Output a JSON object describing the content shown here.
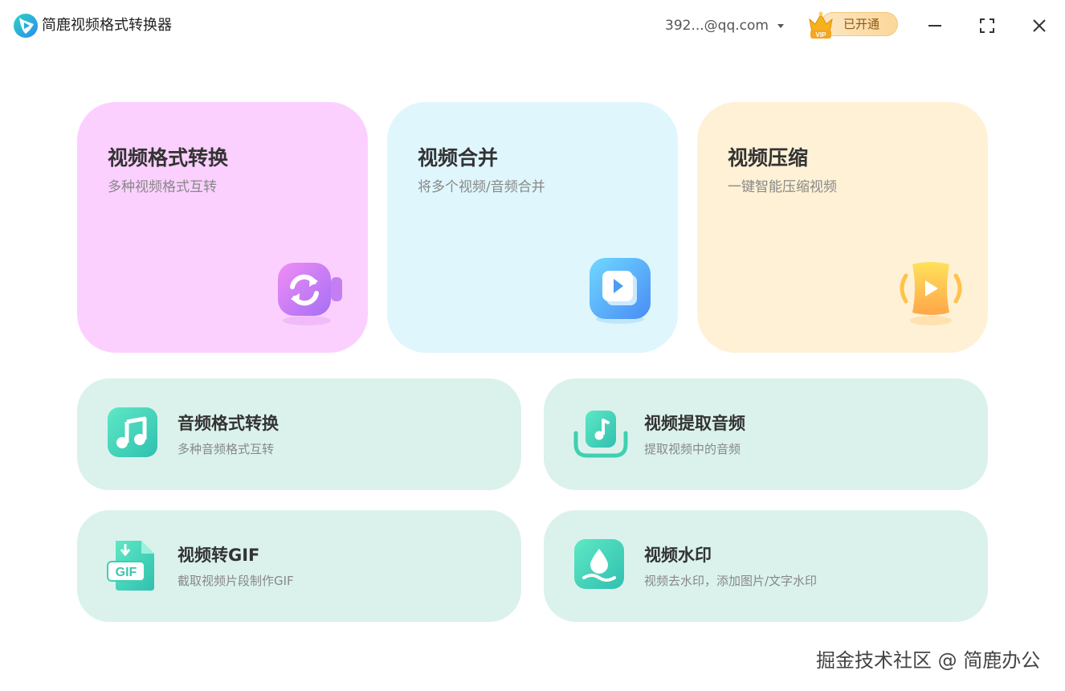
{
  "app": {
    "title": "简鹿视频格式转换器",
    "account": "392...@qq.com",
    "vip_badge": "VIP",
    "vip_status": "已开通"
  },
  "tools_main": [
    {
      "title": "视频格式转换",
      "subtitle": "多种视频格式互转"
    },
    {
      "title": "视频合并",
      "subtitle": "将多个视频/音频合并"
    },
    {
      "title": "视频压缩",
      "subtitle": "一键智能压缩视频"
    }
  ],
  "tools_secondary": [
    {
      "title": "音频格式转换",
      "subtitle": "多种音频格式互转"
    },
    {
      "title": "视频提取音频",
      "subtitle": "提取视频中的音频"
    },
    {
      "title": "视频转GIF",
      "subtitle": "截取视频片段制作GIF",
      "icon_text": "GIF"
    },
    {
      "title": "视频水印",
      "subtitle": "视频去水印，添加图片/文字水印"
    }
  ],
  "watermark": "掘金技术社区 @ 简鹿办公",
  "colors": {
    "convert_card": "#fbd0ff",
    "merge_card": "#dff6fd",
    "compress_card": "#fff1d6",
    "secondary_card": "#dbf2ec",
    "accent_teal": "#3fd0b0"
  }
}
